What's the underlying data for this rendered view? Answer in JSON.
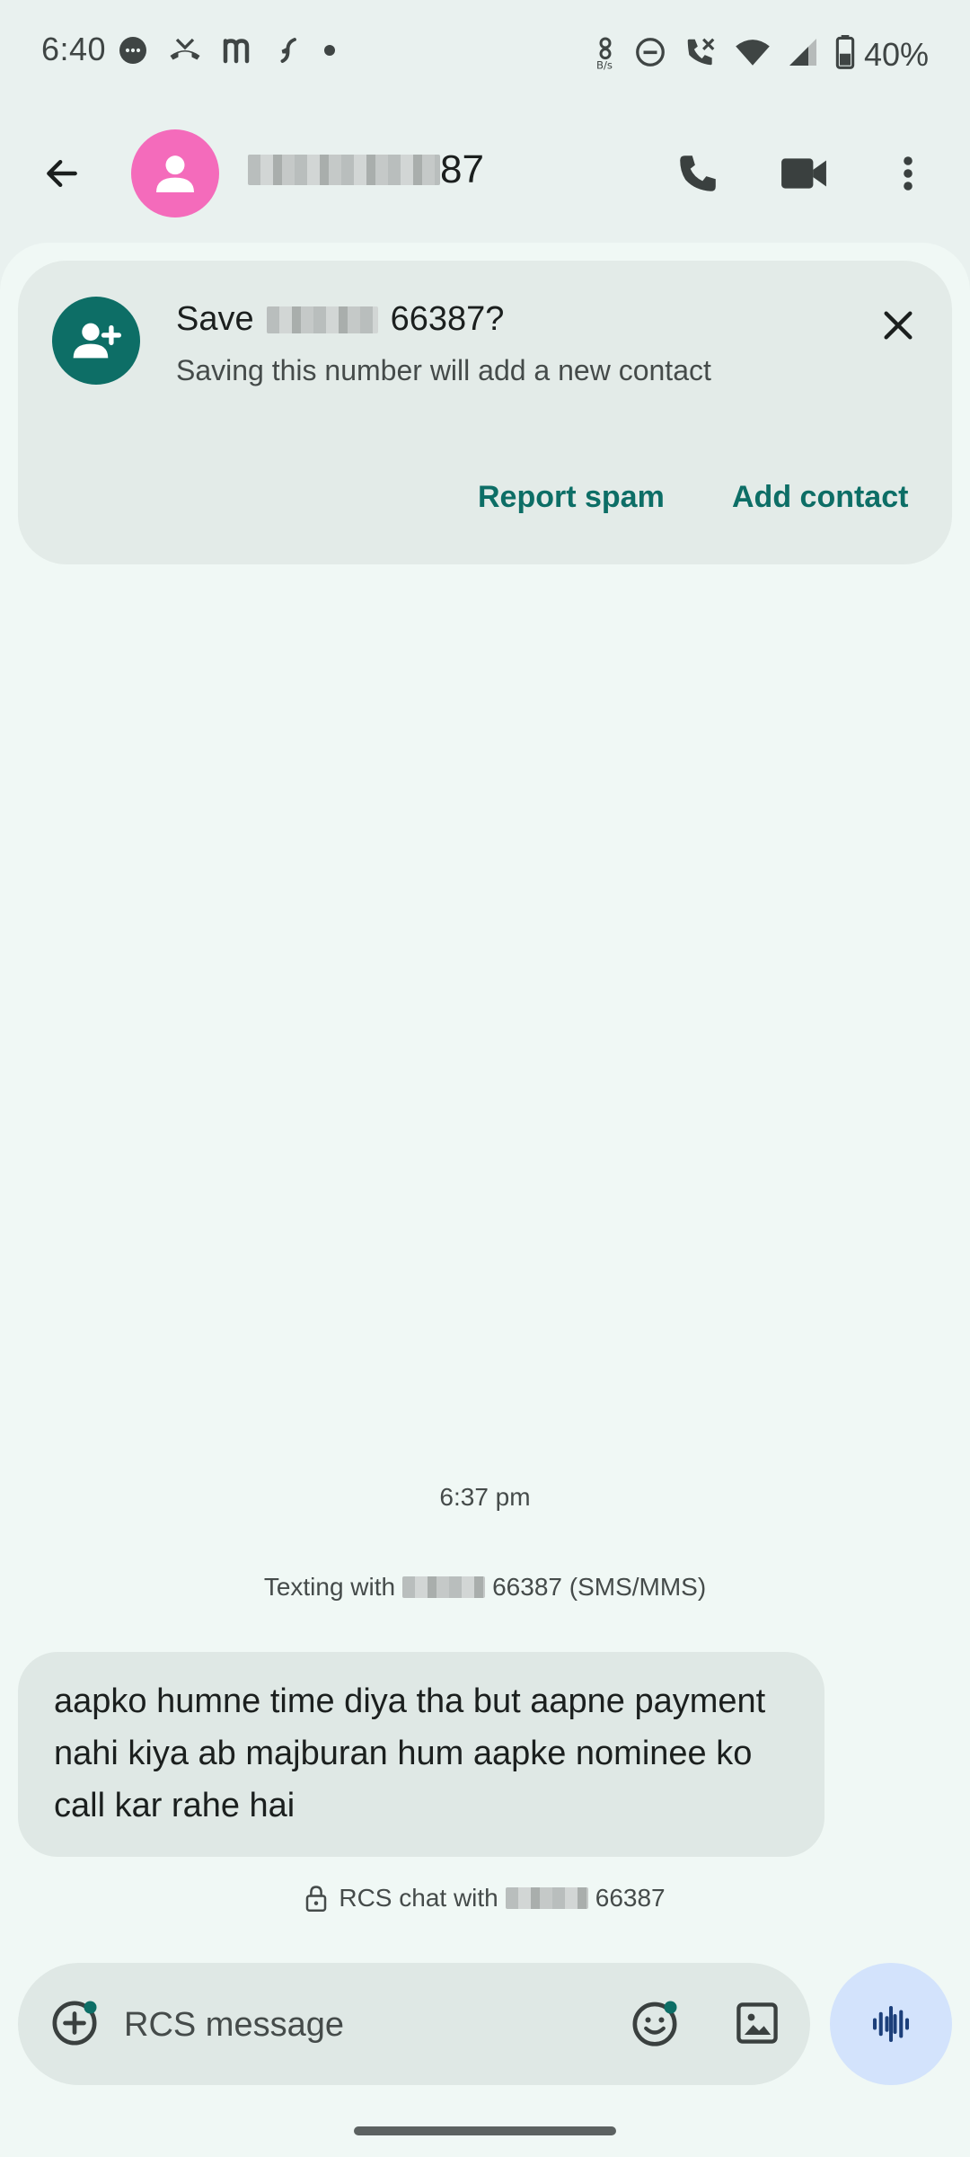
{
  "status_bar": {
    "time": "6:40",
    "battery": "40%",
    "notification_icons": [
      "chat-bubble-icon",
      "missed-call-icon",
      "m-app-icon",
      "bolt-app-icon",
      "dot-icon"
    ],
    "system_icons": [
      "data-speed-icon",
      "do-not-disturb-icon",
      "wifi-calling-icon",
      "wifi-icon",
      "signal-icon",
      "battery-icon"
    ]
  },
  "app_bar": {
    "contact_number_visible_suffix": "87",
    "actions": [
      "phone-icon",
      "video-call-icon",
      "more-vert-icon"
    ]
  },
  "save_card": {
    "title_prefix": "Save",
    "title_suffix": "66387?",
    "subtitle": "Saving this number will add a new contact",
    "report_spam_label": "Report spam",
    "add_contact_label": "Add contact"
  },
  "conversation": {
    "timestamp": "6:37 pm",
    "texting_with_prefix": "Texting with",
    "texting_with_suffix": "66387 (SMS/MMS)",
    "message": "aapko humne time diya tha but aapne payment nahi kiya ab majburan hum aapke nominee ko call kar rahe hai",
    "rcs_prefix": "RCS chat with",
    "rcs_suffix": "66387"
  },
  "composer": {
    "placeholder": "RCS message"
  },
  "colors": {
    "accent": "#0d6e66",
    "avatar": "#f46bbb",
    "voice_button": "#d3e3fc",
    "background": "#f0f8f5"
  }
}
